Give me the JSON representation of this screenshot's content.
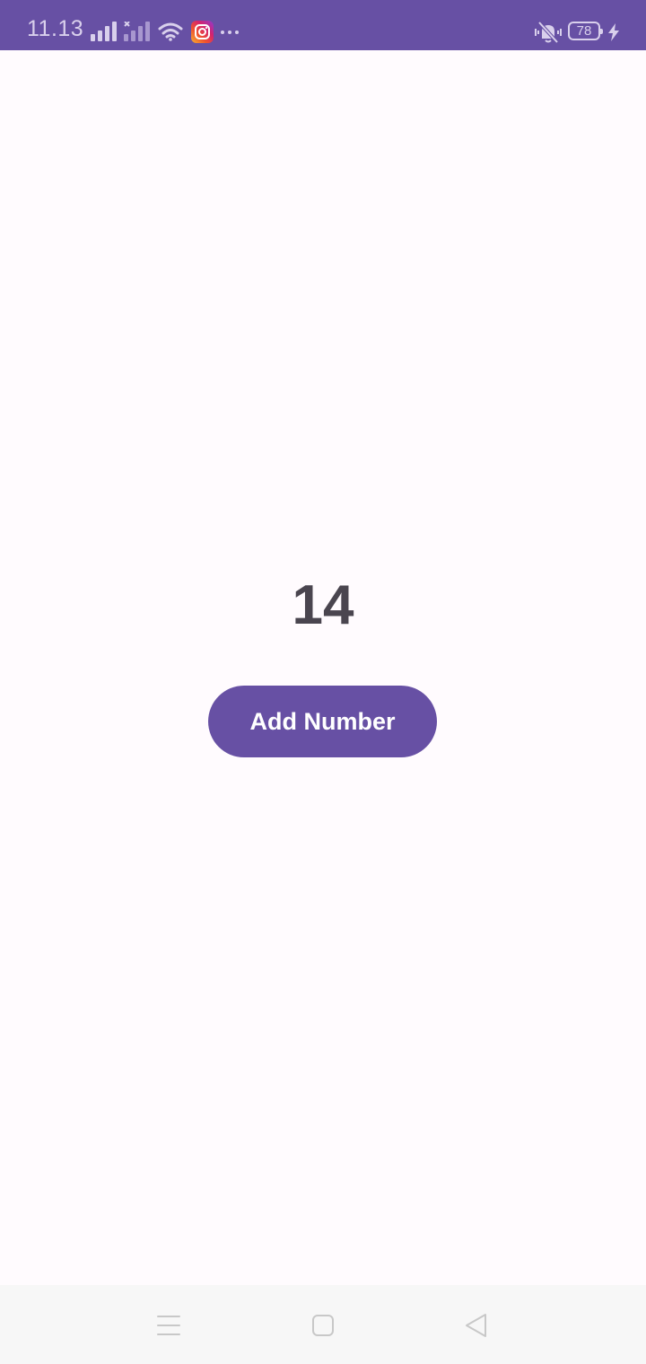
{
  "status_bar": {
    "time": "11.13",
    "battery_level": "78",
    "icons": [
      "signal-icon",
      "signal-no-service-icon",
      "wifi-icon",
      "instagram-notification-icon",
      "more-notifications-icon",
      "vibrate-icon",
      "battery-icon",
      "charging-icon"
    ],
    "background_color": "#6750a4"
  },
  "main": {
    "counter_value": "14",
    "add_button_label": "Add Number",
    "accent_color": "#6750a4"
  },
  "nav_bar": {
    "icons": [
      "menu-icon",
      "home-icon",
      "back-icon"
    ]
  }
}
